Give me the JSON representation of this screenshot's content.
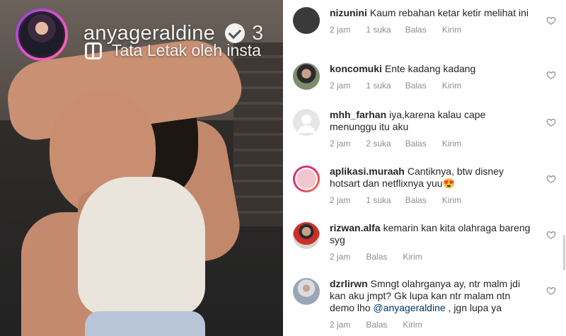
{
  "story": {
    "username": "anyageraldine",
    "time": "3",
    "layout_text": "Tata Letak oleh insta",
    "verified_icon": "verified-badge-icon",
    "layout_icon": "layout-icon"
  },
  "comments": [
    {
      "user": "nizunini",
      "text": "Kaum rebahan ketar ketir melihat ini",
      "time": "2 jam",
      "likes": "1 suka",
      "reply": "Balas",
      "send": "Kirim"
    },
    {
      "user": "koncomuki",
      "text": "Ente kadang kadang",
      "time": "2 jam",
      "likes": "1 suka",
      "reply": "Balas",
      "send": "Kirim"
    },
    {
      "user": "mhh_farhan",
      "text": "iya,karena kalau cape menunggu itu aku",
      "time": "2 jam",
      "likes": "2 suka",
      "reply": "Balas",
      "send": "Kirim"
    },
    {
      "user": "aplikasi.muraah",
      "text": "Cantiknya, btw disney hotsart dan netflixnya yuu😍",
      "time": "2 jam",
      "likes": "1 suka",
      "reply": "Balas",
      "send": "Kirim"
    },
    {
      "user": "rizwan.alfa",
      "text": "kemarin kan kita olahraga bareng syg",
      "time": "2 jam",
      "likes": "",
      "reply": "Balas",
      "send": "Kirim"
    },
    {
      "user": "dzrlirwn",
      "text": "Smngt olahrganya ay, ntr malm jdi kan aku jmpt? Gk lupa kan ntr malam ntn demo lho",
      "mention": "@anyageraldine",
      "text_after": " , jgn lupa ya",
      "time": "2 jam",
      "likes": "",
      "reply": "Balas",
      "send": "Kirim"
    }
  ],
  "colors": {
    "text": "#262626",
    "meta": "#8e8e8e",
    "mention": "#00376b",
    "heart": "#8e8e8e"
  }
}
